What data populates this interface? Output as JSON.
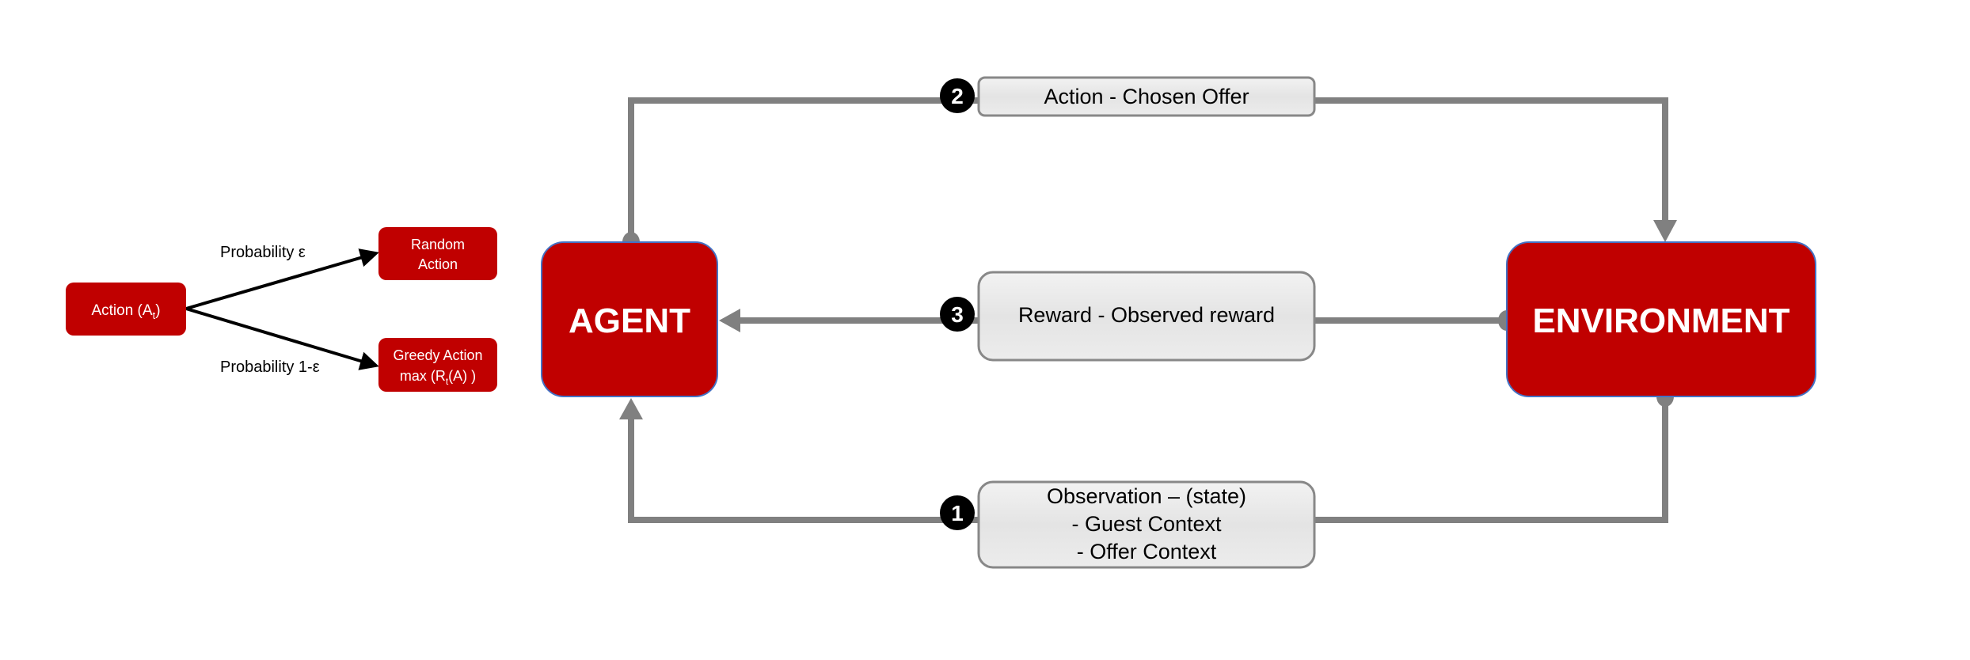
{
  "colors": {
    "red_box": "#c00000",
    "red_border": "#4472c4",
    "connector": "#808080",
    "label_fill": "#e8e8e8",
    "badge": "#000000"
  },
  "policy": {
    "action": "Action (A",
    "action_sub": "t",
    "action_close": ")",
    "prob_epsilon": "Probability ε",
    "prob_one_minus_epsilon": "Probability 1-ε",
    "random_line1": "Random",
    "random_line2": "Action",
    "greedy_line1": "Greedy Action",
    "greedy_line2_a": "max (R",
    "greedy_line2_sub": "t",
    "greedy_line2_b": "(A) )"
  },
  "agent": {
    "label": "AGENT"
  },
  "environment": {
    "label": "ENVIRONMENT"
  },
  "steps": [
    {
      "number": "1",
      "lines": [
        "Observation – (state)",
        "- Guest Context",
        "- Offer  Context"
      ]
    },
    {
      "number": "2",
      "lines": [
        "Action - Chosen Offer"
      ]
    },
    {
      "number": "3",
      "lines": [
        "Reward - Observed reward"
      ]
    }
  ]
}
